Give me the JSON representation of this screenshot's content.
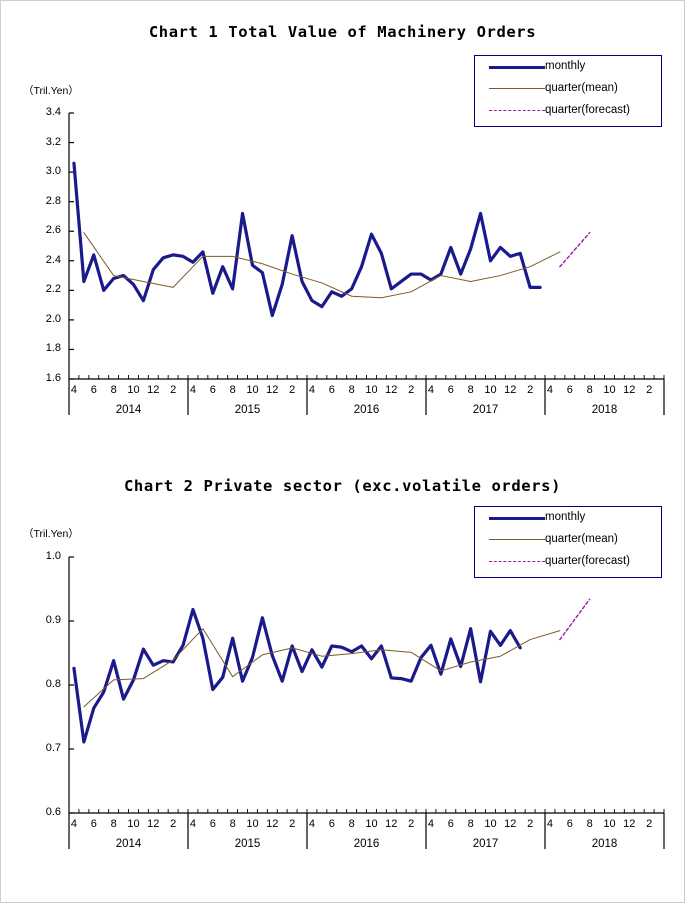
{
  "page": {
    "background": "#ffffff",
    "border_color": "#c8c8c0"
  },
  "colors": {
    "monthly": "#1a1a8c",
    "quarter_mean": "#7a5c28",
    "quarter_forecast": "#a0199c",
    "axis": "#000000",
    "legend_border": "#000080"
  },
  "legend": {
    "items": [
      {
        "key": "monthly",
        "label": "monthly"
      },
      {
        "key": "quarter_mean",
        "label": "quarter(mean)"
      },
      {
        "key": "quarter_forecast",
        "label": "quarter(forecast)"
      }
    ]
  },
  "chart1": {
    "title": "Chart 1 Total Value of Machinery Orders",
    "unit": "（Tril.Yen）"
  },
  "chart2": {
    "title": "Chart 2 Private sector (exc.volatile orders)",
    "unit": "（Tril.Yen）"
  },
  "chart_data": [
    {
      "id": "chart1",
      "type": "line",
      "title": "Chart 1 Total Value of Machinery Orders",
      "xlabel": "",
      "ylabel": "（Tril.Yen）",
      "ylim": [
        1.6,
        3.4
      ],
      "yticks": [
        1.6,
        1.8,
        2.0,
        2.2,
        2.4,
        2.6,
        2.8,
        3.0,
        3.2,
        3.4
      ],
      "ytick_labels": [
        "1.6",
        "1.8",
        "2.0",
        "2.2",
        "2.4",
        "2.6",
        "2.8",
        "3.0",
        "3.2",
        "3.4"
      ],
      "grid": false,
      "legend_position": "top-right",
      "years": [
        "2014",
        "2015",
        "2016",
        "2017",
        "2018"
      ],
      "month_ticks": [
        "4",
        "6",
        "8",
        "10",
        "12",
        "2"
      ],
      "x_start_month": "2014-04",
      "x_months": 60,
      "series": [
        {
          "name": "monthly",
          "color": "#1a1a8c",
          "style": "solid",
          "width": 3.2,
          "x_labels": [
            "2014-04",
            "2014-05",
            "2014-06",
            "2014-07",
            "2014-08",
            "2014-09",
            "2014-10",
            "2014-11",
            "2014-12",
            "2015-01",
            "2015-02",
            "2015-03",
            "2015-04",
            "2015-05",
            "2015-06",
            "2015-07",
            "2015-08",
            "2015-09",
            "2015-10",
            "2015-11",
            "2015-12",
            "2016-01",
            "2016-02",
            "2016-03",
            "2016-04",
            "2016-05",
            "2016-06",
            "2016-07",
            "2016-08",
            "2016-09",
            "2016-10",
            "2016-11",
            "2016-12",
            "2017-01",
            "2017-02",
            "2017-03",
            "2017-04",
            "2017-05",
            "2017-06",
            "2017-07",
            "2017-08",
            "2017-09",
            "2017-10",
            "2017-11",
            "2017-12",
            "2018-01",
            "2018-02",
            "2018-03"
          ],
          "values": [
            3.06,
            2.26,
            2.44,
            2.2,
            2.28,
            2.3,
            2.24,
            2.13,
            2.34,
            2.42,
            2.44,
            2.43,
            2.39,
            2.46,
            2.18,
            2.36,
            2.21,
            2.72,
            2.37,
            2.32,
            2.03,
            2.24,
            2.57,
            2.26,
            2.13,
            2.09,
            2.19,
            2.16,
            2.21,
            2.36,
            2.58,
            2.45,
            2.21,
            2.26,
            2.31,
            2.31,
            2.27,
            2.31,
            2.49,
            2.31,
            2.48,
            2.72,
            2.4,
            2.49,
            2.43,
            2.45,
            2.22,
            2.22
          ]
        },
        {
          "name": "quarter(mean)",
          "color": "#7a5c28",
          "style": "solid",
          "width": 1,
          "x_labels": [
            "2014Q1",
            "2014Q2",
            "2014Q3",
            "2014Q4",
            "2015Q1",
            "2015Q2",
            "2015Q3",
            "2015Q4",
            "2016Q1",
            "2016Q2",
            "2016Q3",
            "2016Q4",
            "2017Q1",
            "2017Q2",
            "2017Q3",
            "2017Q4",
            "2018Q1"
          ],
          "values": [
            2.59,
            2.3,
            2.26,
            2.22,
            2.43,
            2.43,
            2.38,
            2.31,
            2.25,
            2.16,
            2.15,
            2.19,
            2.3,
            2.26,
            2.3,
            2.36,
            2.46
          ]
        },
        {
          "name": "quarter(forecast)",
          "color": "#a0199c",
          "style": "dashed",
          "width": 1.4,
          "x_labels": [
            "2018Q1",
            "2018Q2"
          ],
          "values": [
            2.36,
            2.59
          ]
        }
      ]
    },
    {
      "id": "chart2",
      "type": "line",
      "title": "Chart 2 Private sector (exc.volatile orders)",
      "xlabel": "",
      "ylabel": "（Tril.Yen）",
      "ylim": [
        0.6,
        1.0
      ],
      "yticks": [
        0.6,
        0.7,
        0.8,
        0.9,
        1.0
      ],
      "ytick_labels": [
        "0.6",
        "0.7",
        "0.8",
        "0.9",
        "1.0"
      ],
      "grid": false,
      "legend_position": "top-right",
      "years": [
        "2014",
        "2015",
        "2016",
        "2017",
        "2018"
      ],
      "month_ticks": [
        "4",
        "6",
        "8",
        "10",
        "12",
        "2"
      ],
      "x_start_month": "2014-04",
      "x_months": 60,
      "series": [
        {
          "name": "monthly",
          "color": "#1a1a8c",
          "style": "solid",
          "width": 3.2,
          "x_labels": [
            "2014-04",
            "2014-05",
            "2014-06",
            "2014-07",
            "2014-08",
            "2014-09",
            "2014-10",
            "2014-11",
            "2014-12",
            "2015-01",
            "2015-02",
            "2015-03",
            "2015-04",
            "2015-05",
            "2015-06",
            "2015-07",
            "2015-08",
            "2015-09",
            "2015-10",
            "2015-11",
            "2015-12",
            "2016-01",
            "2016-02",
            "2016-03",
            "2016-04",
            "2016-05",
            "2016-06",
            "2016-07",
            "2016-08",
            "2016-09",
            "2016-10",
            "2016-11",
            "2016-12",
            "2017-01",
            "2017-02",
            "2017-03",
            "2017-04",
            "2017-05",
            "2017-06",
            "2017-07",
            "2017-08",
            "2017-09",
            "2017-10",
            "2017-11",
            "2017-12",
            "2018-01",
            "2018-02",
            "2018-03"
          ],
          "values": [
            0.826,
            0.711,
            0.764,
            0.789,
            0.838,
            0.778,
            0.808,
            0.856,
            0.831,
            0.838,
            0.836,
            0.862,
            0.918,
            0.873,
            0.793,
            0.812,
            0.873,
            0.806,
            0.843,
            0.905,
            0.846,
            0.806,
            0.861,
            0.821,
            0.855,
            0.828,
            0.861,
            0.859,
            0.852,
            0.861,
            0.841,
            0.861,
            0.811,
            0.81,
            0.806,
            0.843,
            0.862,
            0.817,
            0.872,
            0.829,
            0.888,
            0.805,
            0.884,
            0.862,
            0.885,
            0.858
          ]
        },
        {
          "name": "quarter(mean)",
          "color": "#7a5c28",
          "style": "solid",
          "width": 1,
          "x_labels": [
            "2014Q1",
            "2014Q2",
            "2014Q3",
            "2014Q4",
            "2015Q1",
            "2015Q2",
            "2015Q3",
            "2015Q4",
            "2016Q1",
            "2016Q2",
            "2016Q3",
            "2016Q4",
            "2017Q1",
            "2017Q2",
            "2017Q3",
            "2017Q4",
            "2018Q1"
          ],
          "values": [
            0.766,
            0.808,
            0.81,
            0.839,
            0.888,
            0.813,
            0.847,
            0.858,
            0.845,
            0.849,
            0.855,
            0.851,
            0.822,
            0.836,
            0.845,
            0.871,
            0.885
          ]
        },
        {
          "name": "quarter(forecast)",
          "color": "#a0199c",
          "style": "dashed",
          "width": 1.4,
          "x_labels": [
            "2018Q1",
            "2018Q2"
          ],
          "values": [
            0.871,
            0.934
          ]
        }
      ]
    }
  ]
}
